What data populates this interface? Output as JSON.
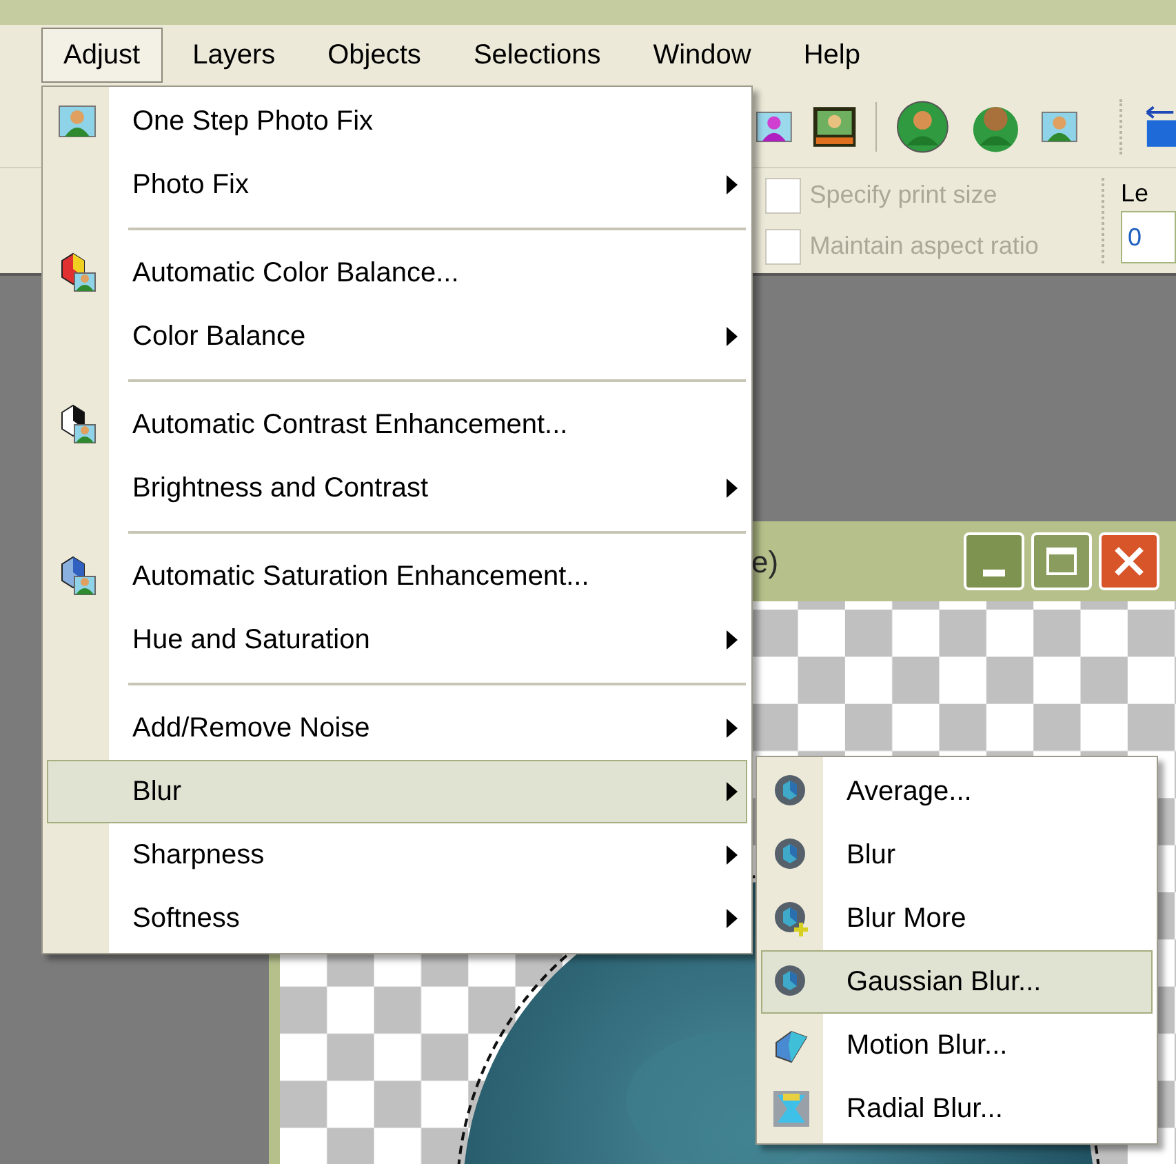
{
  "menubar": [
    {
      "label": "Adjust",
      "selected": true
    },
    {
      "label": "Layers",
      "selected": false
    },
    {
      "label": "Objects",
      "selected": false
    },
    {
      "label": "Selections",
      "selected": false
    },
    {
      "label": "Window",
      "selected": false
    },
    {
      "label": "Help",
      "selected": false
    }
  ],
  "toolbar": {
    "options": [
      {
        "label": "Specify print size",
        "checked": false,
        "disabled": true
      },
      {
        "label": "Maintain aspect ratio",
        "checked": false,
        "disabled": true
      }
    ],
    "field": {
      "label": "Le",
      "value": "0"
    }
  },
  "image_window": {
    "title": "e)"
  },
  "adjust_menu": [
    {
      "kind": "item",
      "label": "One Step Photo Fix",
      "submenu": false,
      "selected": false
    },
    {
      "kind": "item",
      "label": "Photo Fix",
      "submenu": true,
      "selected": false
    },
    {
      "kind": "separator"
    },
    {
      "kind": "item",
      "label": "Automatic Color Balance...",
      "submenu": false,
      "selected": false
    },
    {
      "kind": "item",
      "label": "Color Balance",
      "submenu": true,
      "selected": false
    },
    {
      "kind": "separator"
    },
    {
      "kind": "item",
      "label": "Automatic Contrast Enhancement...",
      "submenu": false,
      "selected": false
    },
    {
      "kind": "item",
      "label": "Brightness and Contrast",
      "submenu": true,
      "selected": false
    },
    {
      "kind": "separator"
    },
    {
      "kind": "item",
      "label": "Automatic Saturation Enhancement...",
      "submenu": false,
      "selected": false
    },
    {
      "kind": "item",
      "label": "Hue and Saturation",
      "submenu": true,
      "selected": false
    },
    {
      "kind": "separator"
    },
    {
      "kind": "item",
      "label": "Add/Remove Noise",
      "submenu": true,
      "selected": false
    },
    {
      "kind": "item",
      "label": "Blur",
      "submenu": true,
      "selected": true
    },
    {
      "kind": "item",
      "label": "Sharpness",
      "submenu": true,
      "selected": false
    },
    {
      "kind": "item",
      "label": "Softness",
      "submenu": true,
      "selected": false
    }
  ],
  "blur_submenu": [
    {
      "label": "Average...",
      "selected": false
    },
    {
      "label": "Blur",
      "selected": false
    },
    {
      "label": "Blur More",
      "selected": false
    },
    {
      "label": "Gaussian Blur...",
      "selected": true
    },
    {
      "label": "Motion Blur...",
      "selected": false
    },
    {
      "label": "Radial Blur...",
      "selected": false
    }
  ]
}
